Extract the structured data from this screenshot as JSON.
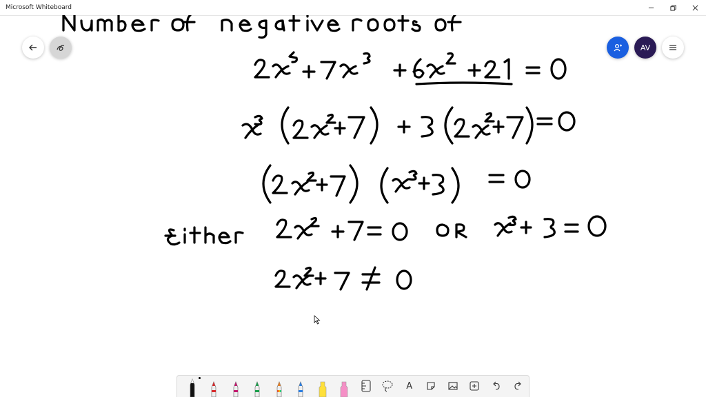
{
  "window": {
    "title": "Microsoft Whiteboard",
    "controls": [
      "minimize-icon",
      "restore-icon",
      "close-icon"
    ]
  },
  "header": {
    "avatar_initials": "AV",
    "colors": {
      "user_button": "#1a5fe0",
      "avatar": "#2a1a55"
    }
  },
  "board": {
    "handwriting": [
      "Number of negative roots of",
      "2x^5 + 7x^3 + 6x^2 + 21 = 0",
      "x^3 (2x^2+7) + 3(2x^2+7) = 0",
      "(2x^2+7) (x^3+3) = 0",
      "Either 2x^2 + 7 = 0 or x^3 + 3 = 0",
      "2x^2+7 ≠ 0"
    ]
  },
  "toolbar": {
    "tools": [
      {
        "name": "pen-black",
        "color": "#111111",
        "active": true
      },
      {
        "name": "pen-red",
        "color": "#d8282a"
      },
      {
        "name": "pen-magenta",
        "color": "#c2186e"
      },
      {
        "name": "pen-green",
        "color": "#1b9e4b"
      },
      {
        "name": "pen-rainbow",
        "color": "#e67e22"
      },
      {
        "name": "pen-blue",
        "color": "#2a7de1"
      },
      {
        "name": "highlighter-yellow",
        "color": "#ffe03a"
      },
      {
        "name": "highlighter-pink",
        "color": "#f58fc6"
      },
      {
        "name": "ruler-icon"
      },
      {
        "name": "lasso-icon"
      },
      {
        "name": "text-icon",
        "label": "A"
      },
      {
        "name": "note-icon"
      },
      {
        "name": "image-icon"
      },
      {
        "name": "add-icon"
      },
      {
        "name": "undo-icon"
      },
      {
        "name": "redo-icon"
      }
    ]
  }
}
